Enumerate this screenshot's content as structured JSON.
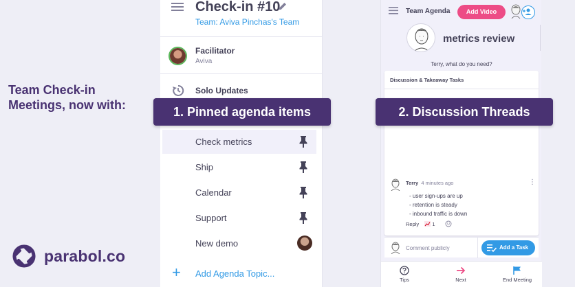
{
  "headline": "Team Check-in Meetings, now with:",
  "logo": {
    "text": "parabol.co"
  },
  "callouts": {
    "pinned": "1. Pinned agenda items",
    "threads": "2. Discussion Threads"
  },
  "left_panel": {
    "meeting_title": "Check-in #10",
    "team_link": "Team: Aviva Pinchas's Team",
    "facilitator_label": "Facilitator",
    "facilitator_name": "Aviva",
    "solo_updates": "Solo Updates",
    "agenda_items": [
      {
        "label": "Check metrics",
        "pinned": true,
        "active": true
      },
      {
        "label": "Ship",
        "pinned": true,
        "active": false
      },
      {
        "label": "Calendar",
        "pinned": true,
        "active": false
      },
      {
        "label": "Support",
        "pinned": true,
        "active": false
      },
      {
        "label": "New demo",
        "pinned": false,
        "active": false
      }
    ],
    "add_topic": "Add Agenda Topic..."
  },
  "right_panel": {
    "title": "Team Agenda",
    "add_video": "Add Video",
    "topic_title": "metrics review",
    "prompt": "Terry, what do you need?",
    "card_header": "Discussion & Takeaway Tasks",
    "comment": {
      "author": "Terry",
      "time": "4 minutes ago",
      "lines": [
        "- user sign-ups are up",
        "- retention is steady",
        "- inbound traffic is down"
      ],
      "reply": "Reply",
      "reaction_count": "1"
    },
    "composer_placeholder": "Comment publicly",
    "add_task": "Add a Task",
    "bottom_bar": {
      "tips": "Tips",
      "next": "Next",
      "end": "End Meeting"
    }
  },
  "colors": {
    "brand_purple": "#493272",
    "accent_blue": "#329ae5",
    "accent_pink": "#ed4c86",
    "background": "#eeeef6"
  }
}
